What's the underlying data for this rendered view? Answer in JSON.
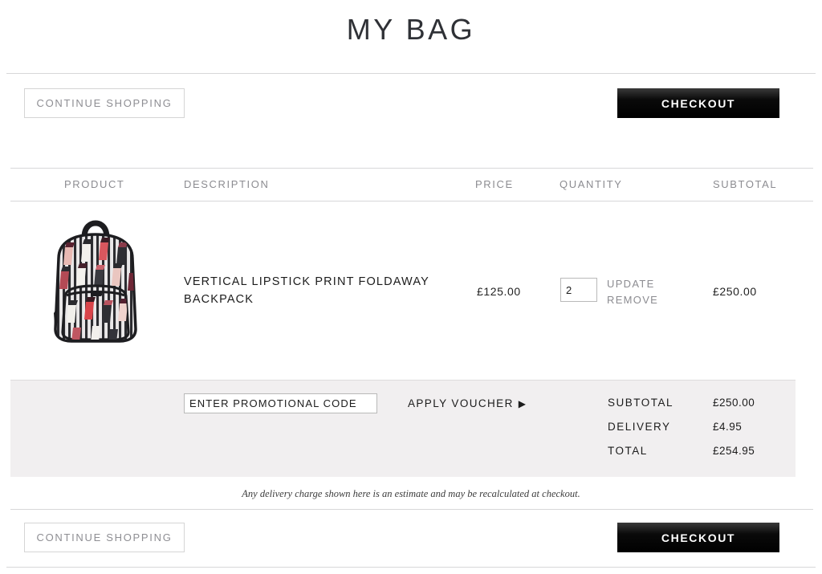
{
  "header": {
    "title": "MY BAG"
  },
  "actions": {
    "continue_shopping_label": "CONTINUE SHOPPING",
    "checkout_label": "CHECKOUT"
  },
  "table": {
    "headers": {
      "product": "PRODUCT",
      "description": "DESCRIPTION",
      "price": "PRICE",
      "quantity": "QUANTITY",
      "subtotal": "SUBTOTAL"
    },
    "rows": [
      {
        "name": "VERTICAL LIPSTICK PRINT FOLDAWAY BACKPACK",
        "price": "£125.00",
        "quantity": "2",
        "update_label": "UPDATE",
        "remove_label": "REMOVE",
        "subtotal": "£250.00",
        "image_alt": "lipstick-print-backpack"
      }
    ]
  },
  "voucher": {
    "placeholder": "ENTER PROMOTIONAL CODE",
    "value": "",
    "apply_label": "APPLY VOUCHER",
    "apply_arrow": "▶"
  },
  "totals": [
    {
      "label": "SUBTOTAL",
      "value": "£250.00"
    },
    {
      "label": "DELIVERY",
      "value": "£4.95"
    },
    {
      "label": "TOTAL",
      "value": "£254.95"
    }
  ],
  "notes": {
    "delivery_estimate": "Any delivery charge shown here is an estimate and may be recalculated at checkout."
  },
  "colors": {
    "panel_bg": "#f1eff0",
    "checkout_bg": "#000000",
    "muted_text": "#8c8c91",
    "rule": "#d7d7d9"
  }
}
